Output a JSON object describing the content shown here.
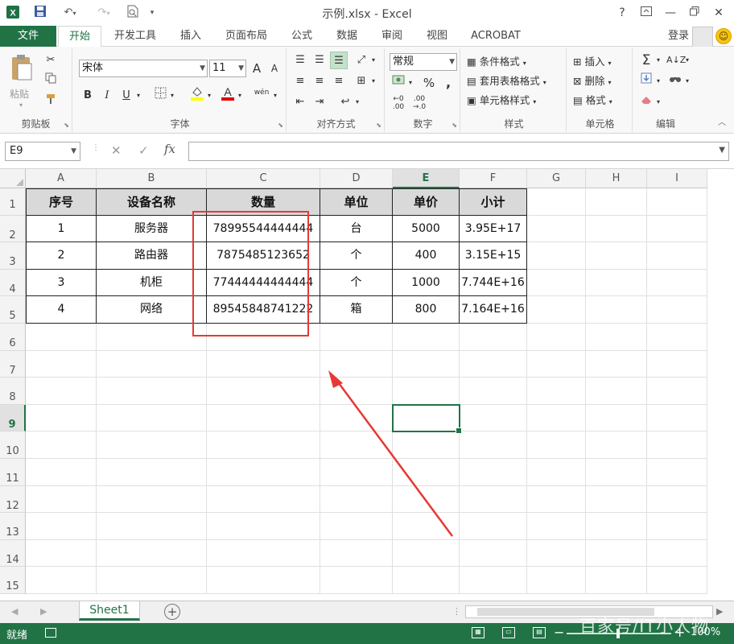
{
  "titlebar": {
    "app_title": "示例.xlsx - Excel",
    "help_label": "?"
  },
  "ribbon_tabs": {
    "file": "文件",
    "tabs": [
      "开始",
      "开发工具",
      "插入",
      "页面布局",
      "公式",
      "数据",
      "审阅",
      "视图",
      "ACROBAT"
    ],
    "active_tab": "开始",
    "login": "登录"
  },
  "ribbon": {
    "clipboard": {
      "paste": "粘贴",
      "label": "剪贴板"
    },
    "font": {
      "name": "宋体",
      "size": "11",
      "grow": "A",
      "shrink": "A",
      "bold": "B",
      "italic": "I",
      "underline": "U",
      "phonetic": "wén",
      "label": "字体"
    },
    "alignment": {
      "label": "对齐方式"
    },
    "number": {
      "format": "常规",
      "percent": "%",
      "comma": ",",
      "label": "数字"
    },
    "styles": {
      "conditional": "条件格式",
      "table": "套用表格格式",
      "cell_styles": "单元格样式",
      "label": "样式"
    },
    "cells": {
      "insert": "插入",
      "delete": "删除",
      "format": "格式",
      "label": "单元格"
    },
    "editing": {
      "label": "编辑"
    }
  },
  "formula_bar": {
    "namebox": "E9",
    "fx": "fx",
    "value": ""
  },
  "columns": [
    "A",
    "B",
    "C",
    "D",
    "E",
    "F",
    "G",
    "H",
    "I"
  ],
  "rows": [
    "1",
    "2",
    "3",
    "4",
    "5",
    "6",
    "7",
    "8",
    "9",
    "10",
    "11",
    "12",
    "13",
    "14",
    "15"
  ],
  "table": {
    "headers": [
      "序号",
      "设备名称",
      "数量",
      "单位",
      "单价",
      "小计"
    ],
    "rows": [
      [
        "1",
        "服务器",
        "78995544444444",
        "台",
        "5000",
        "3.95E+17"
      ],
      [
        "2",
        "路由器",
        "7875485123652",
        "个",
        "400",
        "3.15E+15"
      ],
      [
        "3",
        "机柜",
        "77444444444444",
        "个",
        "1000",
        "7.744E+16"
      ],
      [
        "4",
        "网络",
        "89545848741222",
        "箱",
        "800",
        "7.164E+16"
      ]
    ]
  },
  "selection": {
    "cell": "E9",
    "column": "E",
    "row": "9"
  },
  "sheets": {
    "active": "Sheet1"
  },
  "status": {
    "mode": "就绪",
    "zoom": "100%"
  },
  "watermark": "百家号/IT小人物",
  "colors": {
    "accent": "#217346",
    "annotation": "#e53935",
    "header_fill": "#d9d9d9"
  }
}
